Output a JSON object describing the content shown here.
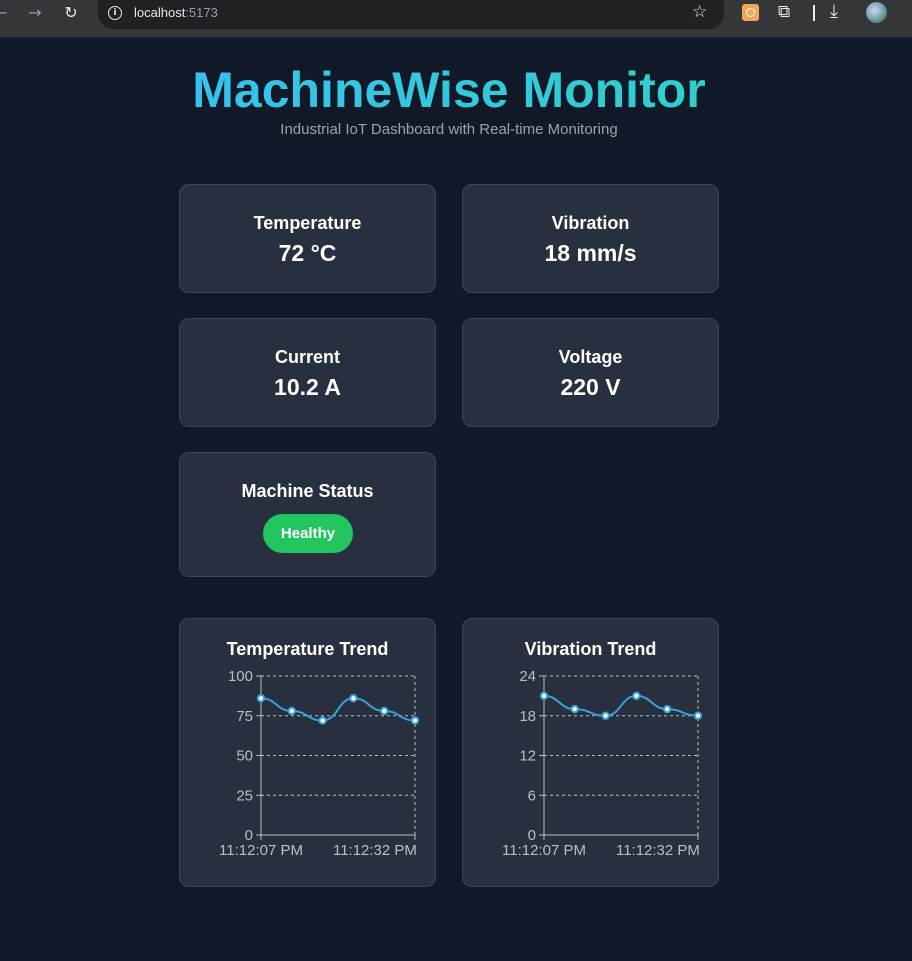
{
  "browser": {
    "url_host": "localhost",
    "url_port": ":5173",
    "icons": [
      "back-arrow-icon",
      "forward-arrow-icon",
      "reload-icon",
      "info-icon",
      "star-icon",
      "extension-icon",
      "puzzle-icon",
      "download-icon",
      "profile-avatar"
    ]
  },
  "header": {
    "title": "MachineWise Monitor",
    "subtitle": "Industrial IoT Dashboard with Real-time Monitoring"
  },
  "metrics": [
    {
      "label": "Temperature",
      "value": "72 °C"
    },
    {
      "label": "Vibration",
      "value": "18 mm/s"
    },
    {
      "label": "Current",
      "value": "10.2 A"
    },
    {
      "label": "Voltage",
      "value": "220 V"
    }
  ],
  "status": {
    "label": "Machine Status",
    "value": "Healthy",
    "color": "#22c55e"
  },
  "colors": {
    "background": "#111827",
    "card": "#283040",
    "line": "#38a3d9",
    "title_gradient_start": "#38bdf8",
    "title_gradient_end": "#2dd4bf"
  },
  "chart_data": [
    {
      "type": "line",
      "title": "Temperature Trend",
      "x": [
        "11:12:07 PM",
        "",
        "",
        "",
        "",
        "11:12:32 PM"
      ],
      "x_tick_labels": [
        "11:12:07 PM",
        "11:12:32 PM"
      ],
      "values": [
        86,
        78,
        72,
        86,
        78,
        72
      ],
      "ylim": [
        0,
        100
      ],
      "y_ticks": [
        0,
        25,
        50,
        75,
        100
      ],
      "grid": true
    },
    {
      "type": "line",
      "title": "Vibration Trend",
      "x": [
        "11:12:07 PM",
        "",
        "",
        "",
        "",
        "11:12:32 PM"
      ],
      "x_tick_labels": [
        "11:12:07 PM",
        "11:12:32 PM"
      ],
      "values": [
        21,
        19,
        18,
        21,
        19,
        18
      ],
      "ylim": [
        0,
        24
      ],
      "y_ticks": [
        0,
        6,
        12,
        18,
        24
      ],
      "grid": true
    }
  ]
}
